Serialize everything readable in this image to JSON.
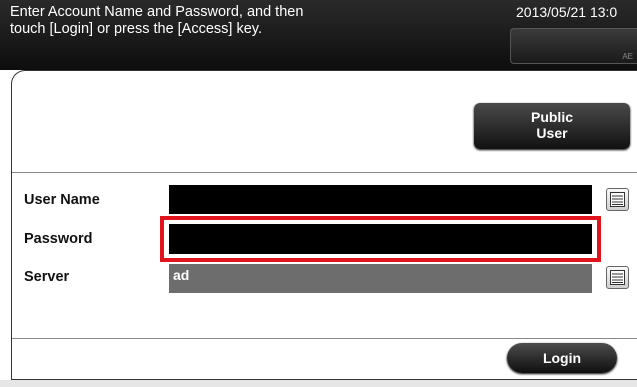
{
  "header": {
    "instruction": "Enter Account Name and Password, and then\ntouch [Login] or press the [Access] key.",
    "datetime": "2013/05/21 13:0",
    "indicator_text": "AE"
  },
  "buttons": {
    "public_user": "Public\nUser",
    "login": "Login"
  },
  "fields": {
    "user_name": {
      "label": "User Name",
      "value": ""
    },
    "password": {
      "label": "Password",
      "value": ""
    },
    "server": {
      "label": "Server",
      "value": "ad"
    }
  },
  "colors": {
    "highlight": "#e0141c",
    "field_active": "#000000",
    "field_readonly": "#6d6d6d"
  },
  "icons": {
    "keyboard": "keyboard-icon"
  }
}
